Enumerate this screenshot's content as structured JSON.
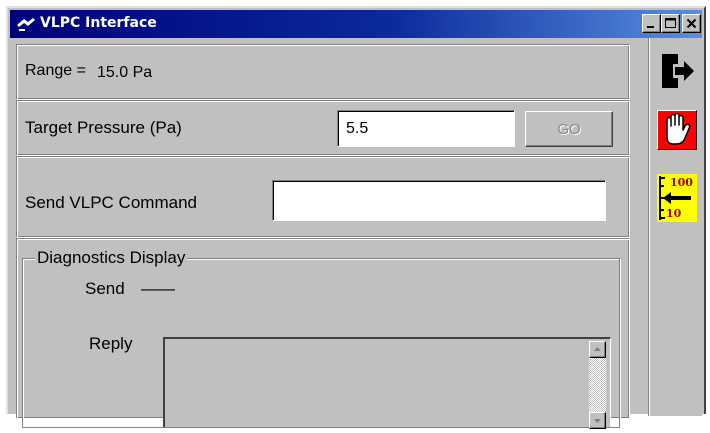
{
  "window": {
    "title": "VLPC Interface",
    "title_icon": "signal-icon",
    "controls": [
      "minimize-icon",
      "maximize-icon",
      "close-icon"
    ]
  },
  "range": {
    "label": "Range =",
    "value": "15.0 Pa"
  },
  "target": {
    "label": "Target Pressure (Pa)",
    "value": "5.5",
    "go_label": "GO"
  },
  "command": {
    "label": "Send VLPC Command",
    "value": ""
  },
  "diagnostics": {
    "legend": "Diagnostics Display",
    "send_label": "Send",
    "send_value": "——",
    "reply_label": "Reply",
    "reply_value": ""
  },
  "sidebar": {
    "exit_icon": "exit-icon",
    "stop_icon": "stop-hand-icon",
    "scale_icon": {
      "name": "range-select-icon",
      "top": "100",
      "bottom": "10"
    }
  },
  "colors": {
    "title_gradient_start": "#00007b",
    "title_gradient_end": "#5a8fe0",
    "stop_button": "#ff0000",
    "scale_button": "#ffff00",
    "face": "#c0c0c0"
  }
}
